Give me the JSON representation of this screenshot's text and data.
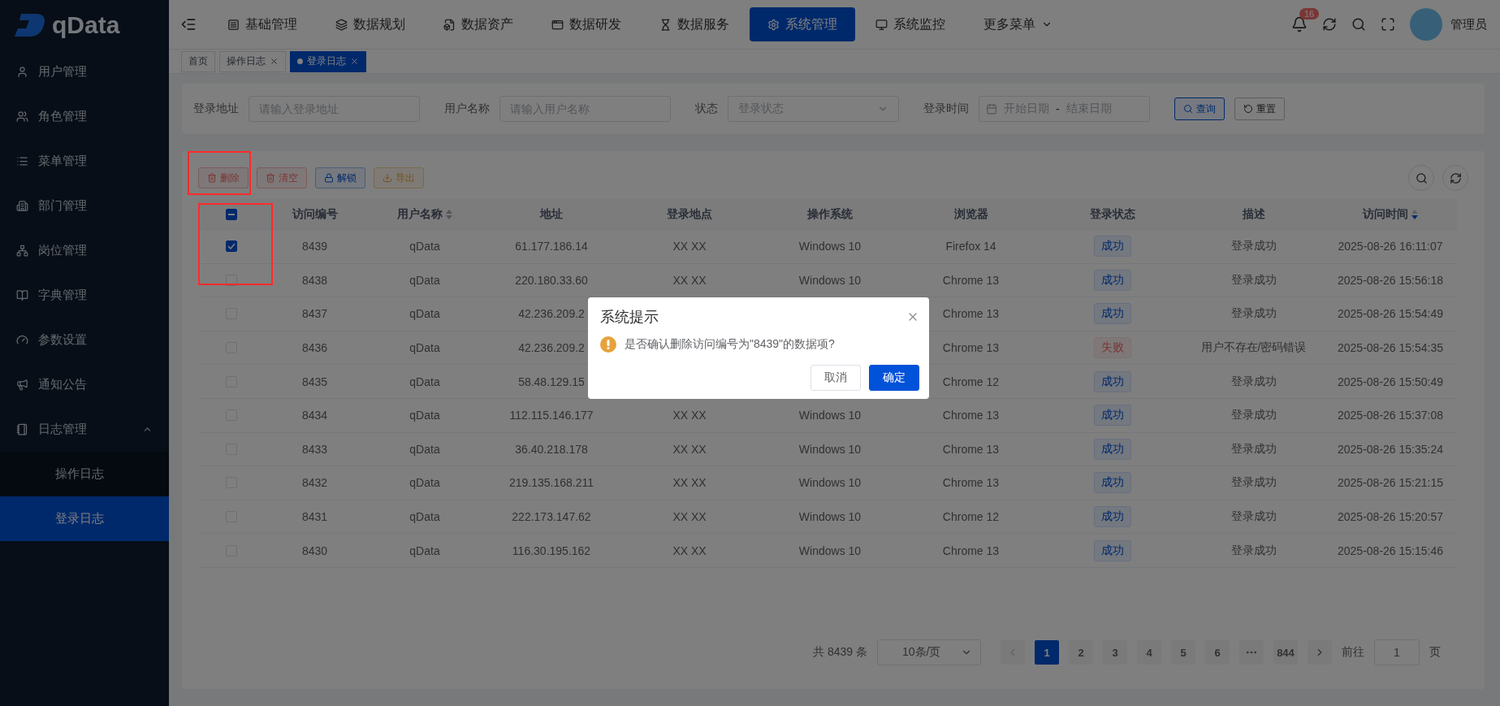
{
  "sidebar": {
    "logo": "qData",
    "items": [
      {
        "label": "用户管理",
        "selected": false
      },
      {
        "label": "角色管理",
        "selected": false
      },
      {
        "label": "菜单管理",
        "selected": false
      },
      {
        "label": "部门管理",
        "selected": false
      },
      {
        "label": "岗位管理",
        "selected": false
      },
      {
        "label": "字典管理",
        "selected": false
      },
      {
        "label": "参数设置",
        "selected": false
      },
      {
        "label": "通知公告",
        "selected": false
      },
      {
        "label": "日志管理",
        "selected": false,
        "expanded": true,
        "children": [
          {
            "label": "操作日志",
            "selected": false
          },
          {
            "label": "登录日志",
            "selected": true
          }
        ]
      }
    ]
  },
  "topnav": {
    "items": [
      {
        "label": "基础管理",
        "selected": false,
        "kind": "link"
      },
      {
        "label": "数据规划",
        "selected": false,
        "kind": "link"
      },
      {
        "label": "数据资产",
        "selected": false,
        "kind": "link"
      },
      {
        "label": "数据研发",
        "selected": false,
        "kind": "link"
      },
      {
        "label": "数据服务",
        "selected": false,
        "kind": "link"
      },
      {
        "label": "系统管理",
        "selected": true,
        "kind": "link"
      },
      {
        "label": "系统监控",
        "selected": false,
        "kind": "link"
      },
      {
        "label": "更多菜单",
        "selected": false,
        "kind": "dropdown"
      }
    ],
    "notification_count": "16",
    "user_name": "管理员"
  },
  "tags": [
    {
      "label": "首页",
      "selected": false,
      "closable": false
    },
    {
      "label": "操作日志",
      "selected": false,
      "closable": true
    },
    {
      "label": "登录日志",
      "selected": true,
      "closable": true
    }
  ],
  "filters": [
    {
      "label": "登录地址",
      "kind": "input",
      "placeholder": "请输入登录地址"
    },
    {
      "label": "用户名称",
      "kind": "input",
      "placeholder": "请输入用户名称"
    },
    {
      "label": "状态",
      "kind": "select",
      "placeholder": "登录状态"
    },
    {
      "label": "登录时间",
      "kind": "daterange",
      "start_placeholder": "开始日期",
      "separator": "-",
      "end_placeholder": "结束日期"
    }
  ],
  "filter_buttons": [
    {
      "label": "查询",
      "kind": "primary"
    },
    {
      "label": "重置",
      "kind": "default"
    }
  ],
  "toolbar": [
    {
      "label": "删除",
      "kind": "danger",
      "highlighted": true
    },
    {
      "label": "清空",
      "kind": "danger",
      "highlighted": false
    },
    {
      "label": "解锁",
      "kind": "info",
      "highlighted": false
    },
    {
      "label": "导出",
      "kind": "warning",
      "highlighted": false
    }
  ],
  "table": {
    "select_all_partial": true,
    "selection_highlighted": true,
    "columns": [
      {
        "label": "访问编号",
        "sortable": false,
        "sorted_descending": false
      },
      {
        "label": "用户名称",
        "sortable": true,
        "sorted_descending": false
      },
      {
        "label": "地址",
        "sortable": false,
        "sorted_descending": false
      },
      {
        "label": "登录地点",
        "sortable": false,
        "sorted_descending": false
      },
      {
        "label": "操作系统",
        "sortable": false,
        "sorted_descending": false
      },
      {
        "label": "浏览器",
        "sortable": false,
        "sorted_descending": false
      },
      {
        "label": "登录状态",
        "sortable": false,
        "sorted_descending": false
      },
      {
        "label": "描述",
        "sortable": false,
        "sorted_descending": false
      },
      {
        "label": "访问时间",
        "sortable": true,
        "sorted_descending": true
      }
    ],
    "rows": [
      {
        "checked": true,
        "id": "8439",
        "user": "qData",
        "address": "61.177.186.14",
        "location": "XX XX",
        "os": "Windows 10",
        "browser": "Firefox 14",
        "status": {
          "text": "成功",
          "kind": "success"
        },
        "description": "登录成功",
        "time": "2025-08-26 16:11:07"
      },
      {
        "checked": false,
        "id": "8438",
        "user": "qData",
        "address": "220.180.33.60",
        "location": "XX XX",
        "os": "Windows 10",
        "browser": "Chrome 13",
        "status": {
          "text": "成功",
          "kind": "success"
        },
        "description": "登录成功",
        "time": "2025-08-26 15:56:18"
      },
      {
        "checked": false,
        "id": "8437",
        "user": "qData",
        "address": "42.236.209.2",
        "browser": "Chrome 13",
        "status": {
          "text": "成功",
          "kind": "success"
        },
        "description": "登录成功",
        "time": "2025-08-26 15:54:49"
      },
      {
        "checked": false,
        "id": "8436",
        "user": "qData",
        "address": "42.236.209.2",
        "browser": "Chrome 13",
        "status": {
          "text": "失败",
          "kind": "fail"
        },
        "description": "用户不存在/密码错误",
        "time": "2025-08-26 15:54:35"
      },
      {
        "checked": false,
        "id": "8435",
        "user": "qData",
        "address": "58.48.129.15",
        "browser": "Chrome 12",
        "status": {
          "text": "成功",
          "kind": "success"
        },
        "description": "登录成功",
        "time": "2025-08-26 15:50:49"
      },
      {
        "checked": false,
        "id": "8434",
        "user": "qData",
        "address": "112.115.146.177",
        "location": "XX XX",
        "os": "Windows 10",
        "browser": "Chrome 13",
        "status": {
          "text": "成功",
          "kind": "success"
        },
        "description": "登录成功",
        "time": "2025-08-26 15:37:08"
      },
      {
        "checked": false,
        "id": "8433",
        "user": "qData",
        "address": "36.40.218.178",
        "location": "XX XX",
        "os": "Windows 10",
        "browser": "Chrome 13",
        "status": {
          "text": "成功",
          "kind": "success"
        },
        "description": "登录成功",
        "time": "2025-08-26 15:35:24"
      },
      {
        "checked": false,
        "id": "8432",
        "user": "qData",
        "address": "219.135.168.211",
        "location": "XX XX",
        "os": "Windows 10",
        "browser": "Chrome 13",
        "status": {
          "text": "成功",
          "kind": "success"
        },
        "description": "登录成功",
        "time": "2025-08-26 15:21:15"
      },
      {
        "checked": false,
        "id": "8431",
        "user": "qData",
        "address": "222.173.147.62",
        "location": "XX XX",
        "os": "Windows 10",
        "browser": "Chrome 12",
        "status": {
          "text": "成功",
          "kind": "success"
        },
        "description": "登录成功",
        "time": "2025-08-26 15:20:57"
      },
      {
        "checked": false,
        "id": "8430",
        "user": "qData",
        "address": "116.30.195.162",
        "location": "XX XX",
        "os": "Windows 10",
        "browser": "Chrome 13",
        "status": {
          "text": "成功",
          "kind": "success"
        },
        "description": "登录成功",
        "time": "2025-08-26 15:15:46"
      }
    ]
  },
  "pagination": {
    "total": "共 8439 条",
    "page_size": "10条/页",
    "pages": [
      {
        "label": "1",
        "selected": true,
        "kind": "page"
      },
      {
        "label": "2",
        "selected": false,
        "kind": "page"
      },
      {
        "label": "3",
        "selected": false,
        "kind": "page"
      },
      {
        "label": "4",
        "selected": false,
        "kind": "page"
      },
      {
        "label": "5",
        "selected": false,
        "kind": "page"
      },
      {
        "label": "6",
        "selected": false,
        "kind": "page"
      },
      {
        "selected": false,
        "kind": "ellipsis"
      },
      {
        "label": "844",
        "selected": false,
        "kind": "page"
      }
    ],
    "goto_label": "前往",
    "goto_value": "1",
    "goto_suffix": "页"
  },
  "dialog": {
    "title": "系统提示",
    "message": "是否确认删除访问编号为\"8439\"的数据项?",
    "buttons": [
      {
        "label": "取消",
        "kind": "default"
      },
      {
        "label": "确定",
        "kind": "primary"
      }
    ]
  }
}
